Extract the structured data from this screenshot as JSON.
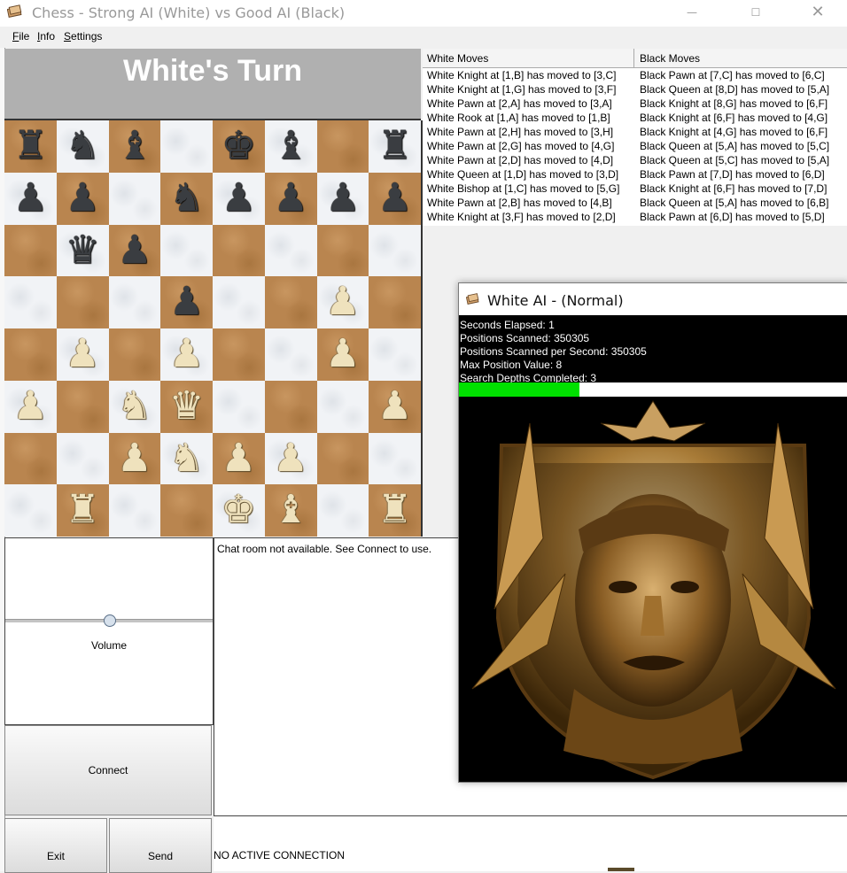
{
  "window": {
    "title": "Chess - Strong AI (White) vs Good AI (Black)",
    "minimize": "—",
    "maximize": "☐",
    "close": "✕",
    "icon": "chess-app-icon"
  },
  "menu": {
    "file": "File",
    "info": "Info",
    "settings": "Settings"
  },
  "turn": {
    "label": "White's Turn",
    "header_color": "#b0b0b0"
  },
  "board": {
    "rows": [
      [
        "bR",
        "bN",
        "bB",
        "",
        "bK",
        "bB",
        "",
        "bR"
      ],
      [
        "bP",
        "bP",
        "",
        "bN",
        "bP",
        "bP",
        "bP",
        "bP"
      ],
      [
        "",
        "bQ",
        "bP",
        "",
        "",
        "",
        "",
        ""
      ],
      [
        "",
        "",
        "",
        "bP",
        "",
        "",
        "wP",
        ""
      ],
      [
        "",
        "wP",
        "",
        "wP",
        "",
        "",
        "wP",
        ""
      ],
      [
        "wP",
        "",
        "wN",
        "wQ",
        "",
        "",
        "",
        "wP"
      ],
      [
        "",
        "",
        "wP",
        "wN",
        "wP",
        "wP",
        "",
        ""
      ],
      [
        "",
        "wR",
        "",
        "",
        "wK",
        "wB",
        "",
        "wR"
      ]
    ],
    "glyphs": {
      "bR": "♜",
      "bN": "♞",
      "bB": "♝",
      "bQ": "♛",
      "bK": "♚",
      "bP": "♟",
      "wR": "♜",
      "wN": "♞",
      "wB": "♝",
      "wQ": "♛",
      "wK": "♚",
      "wP": "♟"
    },
    "light_color": "#f1f3f6",
    "dark_color": "#b9854f"
  },
  "moves": {
    "white_header": "White Moves",
    "black_header": "Black Moves",
    "rows": [
      {
        "white": "White Knight at [1,B] has moved to [3,C]",
        "black": "Black Pawn at [7,C] has moved to [6,C]"
      },
      {
        "white": "White Knight at [1,G] has moved to [3,F]",
        "black": "Black Queen at [8,D] has moved to [5,A]"
      },
      {
        "white": "White Pawn at [2,A] has moved to [3,A]",
        "black": "Black Knight at [8,G] has moved to [6,F]"
      },
      {
        "white": "White Rook at [1,A] has moved to [1,B]",
        "black": "Black Knight at [6,F] has moved to [4,G]"
      },
      {
        "white": "White Pawn at [2,H] has moved to [3,H]",
        "black": "Black Knight at [4,G] has moved to [6,F]"
      },
      {
        "white": "White Pawn at [2,G] has moved to [4,G]",
        "black": "Black Queen at [5,A] has moved to [5,C]"
      },
      {
        "white": "White Pawn at [2,D] has moved to [4,D]",
        "black": "Black Queen at [5,C] has moved to [5,A]"
      },
      {
        "white": "White Queen at [1,D] has moved to [3,D]",
        "black": "Black Pawn at [7,D] has moved to [6,D]"
      },
      {
        "white": "White Bishop at [1,C] has moved to [5,G]",
        "black": "Black Knight at [6,F] has moved to [7,D]"
      },
      {
        "white": "White Pawn at [2,B] has moved to [4,B]",
        "black": "Black Queen at [5,A] has moved to [6,B]"
      },
      {
        "white": "White Knight at [3,F] has moved to [2,D]",
        "black": "Black Pawn at [6,D] has moved to [5,D]"
      }
    ]
  },
  "ai_window": {
    "title": "White AI - (Normal)",
    "icon": "chess-app-icon",
    "stats": [
      "Seconds Elapsed: 1",
      "Positions Scanned: 350305",
      "Positions Scanned per Second: 350305",
      "Max Position Value: 8",
      "Search Depths Completed: 3"
    ],
    "progress": 0.31,
    "progress_color": "#00e000",
    "portrait": "ai-portrait-image"
  },
  "volume": {
    "label": "Volume",
    "level": 0.5
  },
  "chat": {
    "message": "Chat room not available. See Connect to use."
  },
  "buttons": {
    "connect": "Connect",
    "exit": "Exit",
    "send": "Send"
  },
  "status": {
    "text": "NO ACTIVE CONNECTION"
  }
}
